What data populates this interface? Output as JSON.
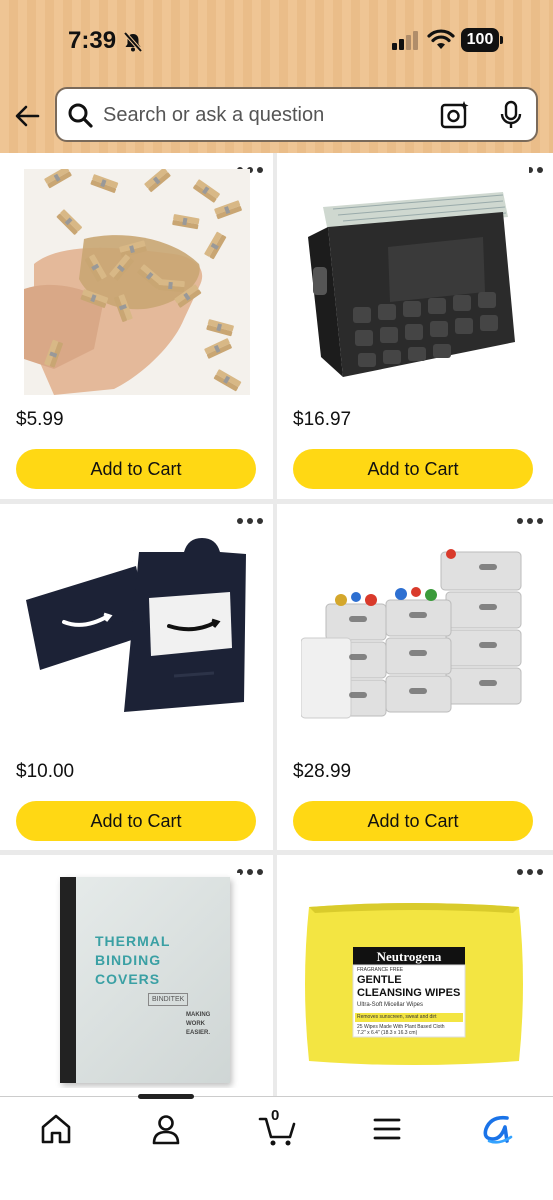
{
  "status_bar": {
    "time": "7:39",
    "battery": "100",
    "icons": [
      "bell-slash-icon",
      "signal-icon",
      "wifi-icon",
      "battery-icon"
    ]
  },
  "search": {
    "placeholder": "Search or ask a question",
    "icons": [
      "back-arrow-icon",
      "search-icon",
      "camera-icon",
      "microphone-icon"
    ]
  },
  "products": [
    {
      "price": "$5.99",
      "button": "Add to Cart",
      "image": "wooden-clothespins"
    },
    {
      "price": "$16.97",
      "button": "Add to Cart",
      "image": "black-file-box"
    },
    {
      "price": "$10.00",
      "button": "Add to Cart",
      "image": "amazon-gift-card"
    },
    {
      "price": "$28.99",
      "button": "Add to Cart",
      "image": "white-storage-baskets"
    },
    {
      "image": "thermal-binding-covers",
      "label": {
        "line1": "THERMAL",
        "line2": "BINDING",
        "line3": "COVERS",
        "brand": "BINDITEK",
        "tagline1": "MAKING",
        "tagline2": "WORK",
        "tagline3": "EASIER."
      }
    },
    {
      "image": "neutrogena-wipes",
      "label": {
        "brand": "Neutrogena",
        "small": "FRAGRANCE FREE",
        "title1": "GENTLE",
        "title2": "CLEANSING WIPES",
        "sub": "Ultra-Soft Micellar Wipes",
        "band": "Removes sunscreen, sweat and dirt",
        "count": "25 Wipes Made With Plant Based Cloth",
        "size": "7.2\" x 6.4\" (18.3 x 16.3 cm)"
      }
    }
  ],
  "bottom_nav": {
    "cart_count": "0",
    "items": [
      "home-icon",
      "account-icon",
      "cart-icon",
      "menu-icon",
      "rufus-icon"
    ]
  },
  "colors": {
    "header": "#efc594",
    "button": "#ffd814",
    "accent": "#1a73e8"
  }
}
